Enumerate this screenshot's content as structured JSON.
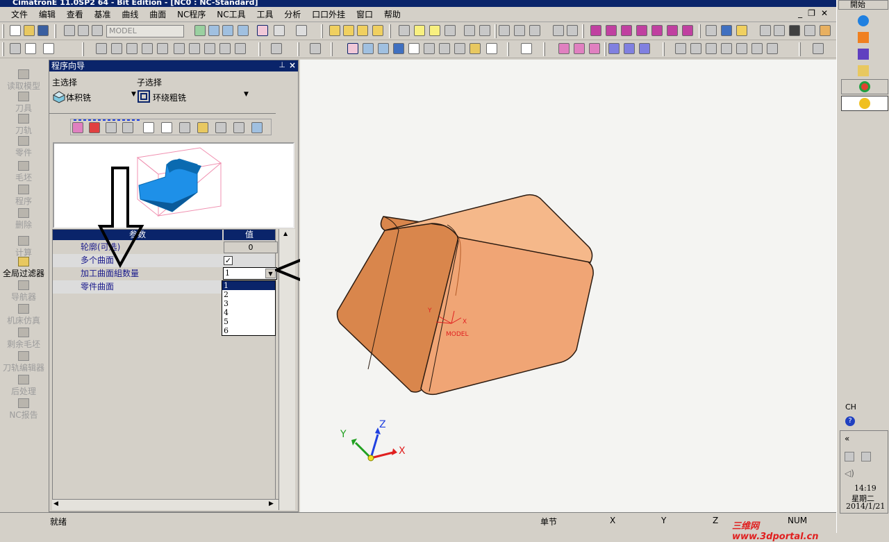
{
  "title_bar": {
    "text": "CimatronE 11.0SP2 64 - Bit Edition - [NC0 : NC-Standard]"
  },
  "menu": [
    "文件",
    "编辑",
    "查看",
    "基准",
    "曲线",
    "曲面",
    "NC程序",
    "NC工具",
    "工具",
    "分析",
    "口口外挂",
    "窗口",
    "帮助"
  ],
  "toolbar": {
    "model_combo": "MODEL"
  },
  "left_bar": {
    "items": [
      {
        "label": "读取模型",
        "icon": "load-model-icon"
      },
      {
        "label": "刀具",
        "icon": "tool-icon"
      },
      {
        "label": "刀轨",
        "icon": "toolpath-icon"
      },
      {
        "label": "零件",
        "icon": "part-icon"
      },
      {
        "label": "毛坯",
        "icon": "stock-icon"
      },
      {
        "label": "程序",
        "icon": "procedure-icon"
      },
      {
        "label": "删除",
        "icon": "delete-icon"
      },
      {
        "label": "计算",
        "icon": "compute-icon"
      },
      {
        "label": "全局过滤器",
        "icon": "global-filter-icon"
      },
      {
        "label": "导航器",
        "icon": "navigator-icon"
      },
      {
        "label": "机床仿真",
        "icon": "machine-sim-icon"
      },
      {
        "label": "剩余毛坯",
        "icon": "remaining-stock-icon"
      },
      {
        "label": "刀轨编辑器",
        "icon": "toolpath-editor-icon"
      },
      {
        "label": "后处理",
        "icon": "post-process-icon"
      },
      {
        "label": "NC报告",
        "icon": "nc-report-icon"
      }
    ]
  },
  "wizard": {
    "title": "程序向导",
    "main_label": "主选择",
    "main_value": "体积铣",
    "sub_label": "子选择",
    "sub_value": "环绕粗铣",
    "table": {
      "headers": [
        "参数",
        "值"
      ],
      "rows": [
        {
          "param": "轮廓(可选)",
          "value": "0"
        },
        {
          "param": "多个曲面",
          "value": "✓"
        },
        {
          "param": "加工曲面組数量",
          "value": "1"
        },
        {
          "param": "零件曲面",
          "value": ""
        }
      ]
    },
    "dropdown_options": [
      "1",
      "2",
      "3",
      "4",
      "5",
      "6"
    ]
  },
  "viewport": {
    "model_label": "MODEL",
    "axis_x": "X",
    "axis_y": "Y",
    "axis_z": "Z",
    "small_x": "X",
    "small_y": "Y"
  },
  "status": {
    "ready": "就绪",
    "mode": "单节",
    "x": "X",
    "y": "Y",
    "z": "Z",
    "num": "NUM"
  },
  "taskbar": {
    "top_label": "開始",
    "ch": "CH",
    "time": "14:19",
    "weekday": "星期二",
    "date": "2014/1/21"
  },
  "watermark": "三维网 www.3dportal.cn"
}
